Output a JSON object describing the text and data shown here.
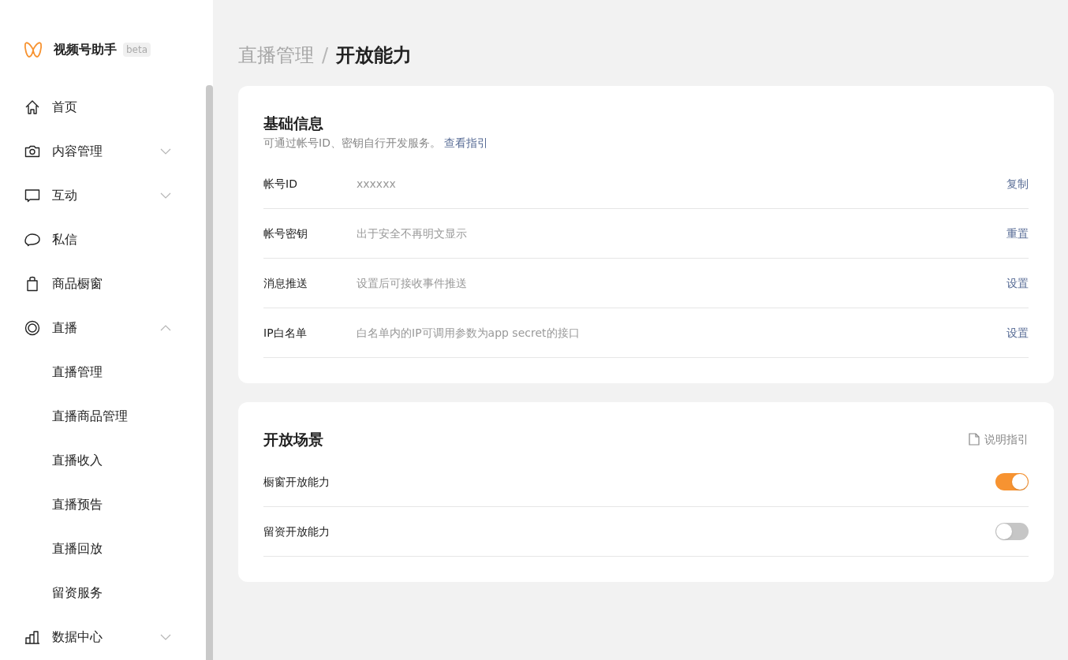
{
  "brand": {
    "name": "视频号助手",
    "badge": "beta"
  },
  "sidebar": {
    "items": [
      {
        "kind": "home",
        "label": "首页"
      },
      {
        "kind": "camera",
        "label": "内容管理",
        "expanded": false
      },
      {
        "kind": "chat",
        "label": "互动",
        "expanded": false
      },
      {
        "kind": "bubble",
        "label": "私信"
      },
      {
        "kind": "bag",
        "label": "商品橱窗"
      },
      {
        "kind": "live",
        "label": "直播",
        "expanded": true,
        "children": [
          {
            "label": "直播管理"
          },
          {
            "label": "直播商品管理"
          },
          {
            "label": "直播收入"
          },
          {
            "label": "直播预告"
          },
          {
            "label": "直播回放"
          },
          {
            "label": "留资服务"
          }
        ]
      },
      {
        "kind": "chart",
        "label": "数据中心",
        "expanded": false
      }
    ]
  },
  "breadcrumb_separator": "/",
  "breadcrumb": [
    {
      "label": "直播管理"
    },
    {
      "label": "开放能力"
    }
  ],
  "basic_info": {
    "title": "基础信息",
    "description": "可通过帐号ID、密钥自行开发服务。",
    "link": "查看指引",
    "rows": [
      {
        "label": "帐号ID",
        "value": "xxxxxx",
        "action": "复制"
      },
      {
        "label": "帐号密钥",
        "value": "出于安全不再明文显示",
        "action": "重置"
      },
      {
        "label": "消息推送",
        "value": "设置后可接收事件推送",
        "action": "设置"
      },
      {
        "label": "IP白名单",
        "value": "白名单内的IP可调用参数为app secret的接口",
        "action": "设置"
      }
    ]
  },
  "open_scenes": {
    "title": "开放场景",
    "guide": "说明指引",
    "rows": [
      {
        "label": "橱窗开放能力",
        "on": true
      },
      {
        "label": "留资开放能力",
        "on": false
      }
    ]
  }
}
